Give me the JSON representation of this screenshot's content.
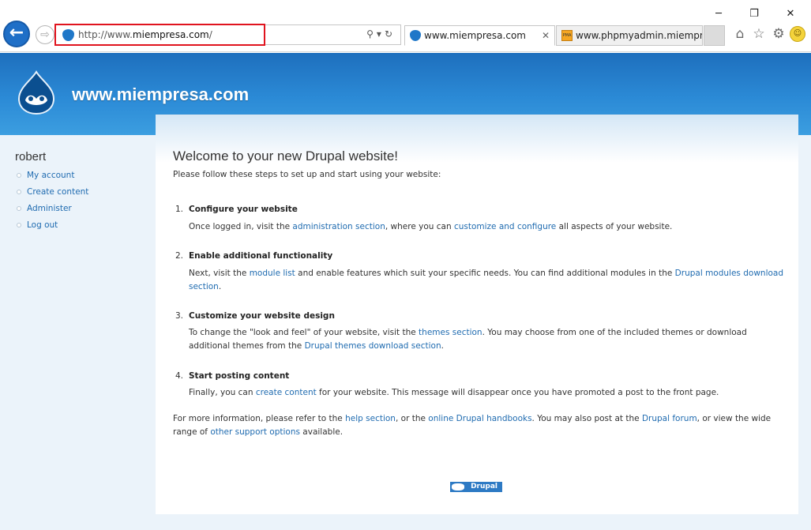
{
  "browser": {
    "address_prefix": "http://www.",
    "address_domain": "miempresa.com",
    "address_suffix": "/",
    "tabs": [
      {
        "label": "www.miempresa.com",
        "close": "✕"
      },
      {
        "label": "www.phpmyadmin.miempr...",
        "icon_text": "PMA"
      }
    ],
    "window_controls": {
      "minimize": "─",
      "restore": "❐",
      "close": "✕"
    }
  },
  "site": {
    "name": "www.miempresa.com"
  },
  "sidebar": {
    "username": "robert",
    "items": [
      {
        "label": "My account"
      },
      {
        "label": "Create content"
      },
      {
        "label": "Administer"
      },
      {
        "label": "Log out"
      }
    ]
  },
  "main": {
    "title": "Welcome to your new Drupal website!",
    "intro": "Please follow these steps to set up and start using your website:",
    "steps": [
      {
        "num": "1.",
        "title": "Configure your website",
        "t1": "Once logged in, visit the ",
        "l1": "administration section",
        "t2": ", where you can ",
        "l2": "customize and configure",
        "t3": " all aspects of your website."
      },
      {
        "num": "2.",
        "title": "Enable additional functionality",
        "t1": "Next, visit the ",
        "l1": "module list",
        "t2": " and enable features which suit your specific needs. You can find additional modules in the ",
        "l2": "Drupal modules download section",
        "t3": "."
      },
      {
        "num": "3.",
        "title": "Customize your website design",
        "t1": "To change the \"look and feel\" of your website, visit the ",
        "l1": "themes section",
        "t2": ". You may choose from one of the included themes or download additional themes from the ",
        "l2": "Drupal themes download section",
        "t3": "."
      },
      {
        "num": "4.",
        "title": "Start posting content",
        "t1": "Finally, you can ",
        "l1": "create content",
        "t2": " for your website. This message will disappear once you have promoted a post to the front page."
      }
    ],
    "footer": {
      "t1": "For more information, please refer to the ",
      "l1": "help section",
      "t2": ", or the ",
      "l2": "online Drupal handbooks",
      "t3": ". You may also post at the ",
      "l3": "Drupal forum",
      "t4": ", or view the wide range of ",
      "l4": "other support options",
      "t5": " available."
    },
    "powered_badge": "Drupal"
  }
}
